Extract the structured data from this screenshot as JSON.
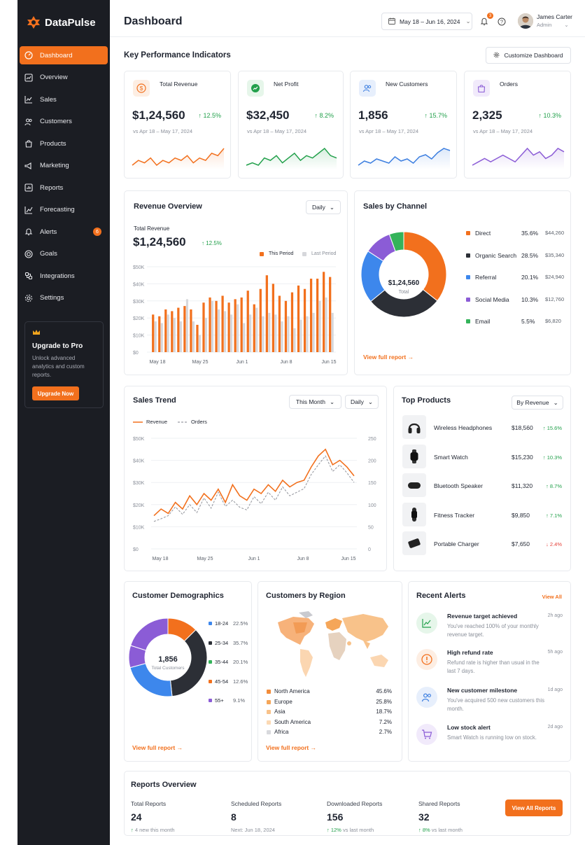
{
  "brand": {
    "name": "DataPulse",
    "accent": "#f2701d",
    "sidebar_bg": "#1b1d23"
  },
  "sidebar": {
    "items": [
      {
        "label": "Dashboard",
        "icon": "dashboard-icon",
        "active": true
      },
      {
        "label": "Overview",
        "icon": "overview-icon"
      },
      {
        "label": "Sales",
        "icon": "sales-chart-icon"
      },
      {
        "label": "Customers",
        "icon": "customers-icon"
      },
      {
        "label": "Products",
        "icon": "products-icon"
      },
      {
        "label": "Marketing",
        "icon": "megaphone-icon"
      },
      {
        "label": "Reports",
        "icon": "reports-icon"
      },
      {
        "label": "Forecasting",
        "icon": "forecast-icon"
      },
      {
        "label": "Alerts",
        "icon": "bell-icon",
        "badge": "6"
      },
      {
        "label": "Goals",
        "icon": "target-icon"
      },
      {
        "label": "Integrations",
        "icon": "integrations-icon"
      },
      {
        "label": "Settings",
        "icon": "gear-icon"
      }
    ],
    "upgrade": {
      "title": "Upgrade to Pro",
      "text": "Unlock advanced analytics and custom reports.",
      "button": "Upgrade Now"
    }
  },
  "header": {
    "title": "Dashboard",
    "date_range": "May 18 – Jun 16, 2024",
    "notifications": "3",
    "user_name": "James Carter",
    "user_role": "Admin"
  },
  "kpi": {
    "title": "Key Performance Indicators",
    "customize_label": "Customize Dashboard",
    "cards": [
      {
        "label": "Total Revenue",
        "value": "$1,24,560",
        "delta": "↑ 12.5%",
        "sub": "vs Apr 18 – May 17, 2024",
        "color": "#f2701d",
        "spark": [
          5,
          7,
          6,
          8,
          5,
          7,
          6,
          8,
          7,
          9,
          6,
          8,
          7,
          10,
          9,
          12
        ]
      },
      {
        "label": "Net Profit",
        "value": "$32,450",
        "delta": "↑ 8.2%",
        "sub": "vs Apr 18 – May 17, 2024",
        "color": "#22a04b",
        "spark": [
          5,
          6,
          5,
          8,
          7,
          9,
          6,
          8,
          10,
          7,
          9,
          8,
          10,
          12,
          9,
          8
        ]
      },
      {
        "label": "New Customers",
        "value": "1,856",
        "delta": "↑ 15.7%",
        "sub": "vs Apr 18 – May 17, 2024",
        "color": "#3d7fe0",
        "spark": [
          5,
          7,
          6,
          8,
          7,
          6,
          9,
          7,
          8,
          6,
          9,
          10,
          8,
          11,
          13,
          12
        ]
      },
      {
        "label": "Orders",
        "value": "2,325",
        "delta": "↑ 10.3%",
        "sub": "vs Apr 18 – May 17, 2024",
        "color": "#8b5cd6",
        "spark": [
          6,
          7,
          8,
          7,
          8,
          9,
          8,
          7,
          9,
          11,
          9,
          10,
          8,
          9,
          11,
          10
        ]
      }
    ]
  },
  "revenue_overview": {
    "title": "Revenue Overview",
    "period": "Daily",
    "total_label": "Total Revenue",
    "total_value": "$1,24,560",
    "delta": "↑ 12.5%",
    "legend_this": "This Period",
    "legend_last": "Last Period",
    "y_ticks": [
      "$50K",
      "$40K",
      "$30K",
      "$20K",
      "$10K",
      "$0"
    ],
    "x_ticks": [
      "May 18",
      "May 25",
      "Jun 1",
      "Jun 8",
      "Jun 15"
    ]
  },
  "sales_by_channel": {
    "title": "Sales by Channel",
    "center_value": "$1,24,560",
    "center_label": "Total",
    "link": "View full report",
    "channels": [
      {
        "name": "Direct",
        "pct": "35.6%",
        "amount": "$44,260",
        "color": "#f2701d"
      },
      {
        "name": "Organic Search",
        "pct": "28.5%",
        "amount": "$35,340",
        "color": "#2c2f36"
      },
      {
        "name": "Referral",
        "pct": "20.1%",
        "amount": "$24,940",
        "color": "#3d87ec"
      },
      {
        "name": "Social Media",
        "pct": "10.3%",
        "amount": "$12,760",
        "color": "#8b5cd6"
      },
      {
        "name": "Email",
        "pct": "5.5%",
        "amount": "$6,820",
        "color": "#34b35a"
      }
    ]
  },
  "sales_trend": {
    "title": "Sales Trend",
    "range": "This Month",
    "period": "Daily",
    "legend_revenue": "Revenue",
    "legend_orders": "Orders",
    "y_left": [
      "$50K",
      "$40K",
      "$30K",
      "$20K",
      "$10K",
      "$0"
    ],
    "y_right": [
      "250",
      "200",
      "150",
      "100",
      "50",
      "0"
    ],
    "x_ticks": [
      "May 18",
      "May 25",
      "Jun 1",
      "Jun 8",
      "Jun 15"
    ]
  },
  "top_products": {
    "title": "Top Products",
    "sort": "By Revenue",
    "items": [
      {
        "name": "Wireless Headphones",
        "revenue": "$18,560",
        "delta": "↑ 15.6%",
        "trend": "up",
        "icon": "headphones-icon"
      },
      {
        "name": "Smart Watch",
        "revenue": "$15,230",
        "delta": "↑ 10.3%",
        "trend": "up",
        "icon": "smartwatch-icon"
      },
      {
        "name": "Bluetooth Speaker",
        "revenue": "$11,320",
        "delta": "↑ 8.7%",
        "trend": "up",
        "icon": "speaker-icon"
      },
      {
        "name": "Fitness Tracker",
        "revenue": "$9,850",
        "delta": "↑ 7.1%",
        "trend": "up",
        "icon": "fitness-tracker-icon"
      },
      {
        "name": "Portable Charger",
        "revenue": "$7,650",
        "delta": "↓ 2.4%",
        "trend": "down",
        "icon": "power-bank-icon"
      }
    ]
  },
  "demographics": {
    "title": "Customer Demographics",
    "center_value": "1,856",
    "center_label": "Total Customers",
    "link": "View full report",
    "groups": [
      {
        "name": "18-24",
        "pct": "22.5%",
        "color": "#3d87ec"
      },
      {
        "name": "25-34",
        "pct": "35.7%",
        "color": "#2c2f36"
      },
      {
        "name": "35-44",
        "pct": "20.1%",
        "color": "#34b35a"
      },
      {
        "name": "45-54",
        "pct": "12.6%",
        "color": "#f2701d"
      },
      {
        "name": "55+",
        "pct": "9.1%",
        "color": "#8b5cd6"
      }
    ]
  },
  "regions": {
    "title": "Customers by Region",
    "link": "View full report",
    "items": [
      {
        "name": "North America",
        "pct": "45.6%",
        "color": "#f28c3a"
      },
      {
        "name": "Europe",
        "pct": "25.8%",
        "color": "#f5a659"
      },
      {
        "name": "Asia",
        "pct": "18.7%",
        "color": "#f8c28a"
      },
      {
        "name": "South America",
        "pct": "7.2%",
        "color": "#fbd9b4"
      },
      {
        "name": "Africa",
        "pct": "2.7%",
        "color": "#d8d9dd"
      }
    ]
  },
  "alerts": {
    "title": "Recent Alerts",
    "view_all": "View All",
    "items": [
      {
        "title": "Revenue target achieved",
        "text": "You've reached 100% of your monthly revenue target.",
        "time": "2h ago",
        "icon": "trend-up-icon",
        "color": "#22a04b",
        "bg": "#e6f6ea"
      },
      {
        "title": "High refund rate",
        "text": "Refund rate is higher than usual in the last 7 days.",
        "time": "5h ago",
        "icon": "warning-icon",
        "color": "#f2701d",
        "bg": "#fdeee3"
      },
      {
        "title": "New customer milestone",
        "text": "You've acquired 500 new customers this month.",
        "time": "1d ago",
        "icon": "users-icon",
        "color": "#3d7fe0",
        "bg": "#e7effc"
      },
      {
        "title": "Low stock alert",
        "text": "Smart Watch is running low on stock.",
        "time": "2d ago",
        "icon": "cart-icon",
        "color": "#8b5cd6",
        "bg": "#f1eafb"
      }
    ]
  },
  "reports": {
    "title": "Reports Overview",
    "button": "View All Reports",
    "items": [
      {
        "label": "Total Reports",
        "value": "24",
        "sub_prefix": "↑",
        "sub": "4 new this month",
        "sub_color": "pos"
      },
      {
        "label": "Scheduled Reports",
        "value": "8",
        "sub_prefix": "",
        "sub": "Next: Jun 18, 2024",
        "sub_color": "muted"
      },
      {
        "label": "Downloaded Reports",
        "value": "156",
        "sub_prefix": "↑ 12%",
        "sub": "vs last month",
        "sub_color": "pos"
      },
      {
        "label": "Shared Reports",
        "value": "32",
        "sub_prefix": "↑ 8%",
        "sub": "vs last month",
        "sub_color": "pos"
      }
    ]
  },
  "chart_data": [
    {
      "type": "bar",
      "title": "Revenue Overview",
      "categories": [
        "May 18",
        "May 19",
        "May 20",
        "May 21",
        "May 22",
        "May 23",
        "May 24",
        "May 25",
        "May 26",
        "May 27",
        "May 28",
        "May 29",
        "May 30",
        "May 31",
        "Jun 1",
        "Jun 2",
        "Jun 3",
        "Jun 4",
        "Jun 5",
        "Jun 6",
        "Jun 7",
        "Jun 8",
        "Jun 9",
        "Jun 10",
        "Jun 11",
        "Jun 12",
        "Jun 13",
        "Jun 14",
        "Jun 15"
      ],
      "series": [
        {
          "name": "This Period",
          "values": [
            22,
            21,
            25,
            24,
            26,
            27,
            25,
            16,
            29,
            32,
            30,
            33,
            29,
            31,
            32,
            36,
            28,
            37,
            45,
            40,
            33,
            30,
            35,
            39,
            37,
            43,
            43,
            47,
            44
          ]
        },
        {
          "name": "Last Period",
          "values": [
            18,
            17,
            22,
            20,
            18,
            31,
            18,
            10,
            20,
            30,
            25,
            24,
            22,
            28,
            17,
            22,
            26,
            21,
            23,
            22,
            18,
            21,
            14,
            19,
            21,
            23,
            30,
            32,
            23
          ]
        }
      ],
      "ylim": [
        0,
        50
      ]
    },
    {
      "type": "pie",
      "title": "Sales by Channel",
      "categories": [
        "Direct",
        "Organic Search",
        "Referral",
        "Social Media",
        "Email"
      ],
      "values": [
        35.6,
        28.5,
        20.1,
        10.3,
        5.5
      ]
    },
    {
      "type": "line",
      "title": "Sales Trend",
      "x": [
        "May 18",
        "May 19",
        "May 20",
        "May 21",
        "May 22",
        "May 23",
        "May 24",
        "May 25",
        "May 26",
        "May 27",
        "May 28",
        "May 29",
        "May 30",
        "May 31",
        "Jun 1",
        "Jun 2",
        "Jun 3",
        "Jun 4",
        "Jun 5",
        "Jun 6",
        "Jun 7",
        "Jun 8",
        "Jun 9",
        "Jun 10",
        "Jun 11",
        "Jun 12",
        "Jun 13",
        "Jun 14",
        "Jun 15"
      ],
      "series": [
        {
          "name": "Revenue",
          "axis": "left",
          "values": [
            15,
            18,
            16,
            21,
            18,
            24,
            20,
            25,
            22,
            27,
            21,
            29,
            24,
            22,
            27,
            25,
            29,
            26,
            31,
            28,
            30,
            31,
            37,
            42,
            45,
            38,
            40,
            37,
            33
          ]
        },
        {
          "name": "Orders",
          "axis": "right",
          "values": [
            62,
            68,
            75,
            95,
            78,
            100,
            82,
            115,
            92,
            128,
            96,
            110,
            94,
            88,
            118,
            102,
            128,
            110,
            140,
            120,
            128,
            136,
            168,
            190,
            210,
            175,
            190,
            172,
            150
          ]
        }
      ],
      "ylim": [
        0,
        50
      ],
      "y2lim": [
        0,
        250
      ]
    },
    {
      "type": "pie",
      "title": "Customer Demographics",
      "categories": [
        "18-24",
        "25-34",
        "35-44",
        "45-54",
        "55+"
      ],
      "values": [
        22.5,
        35.7,
        20.1,
        12.6,
        9.1
      ]
    }
  ]
}
